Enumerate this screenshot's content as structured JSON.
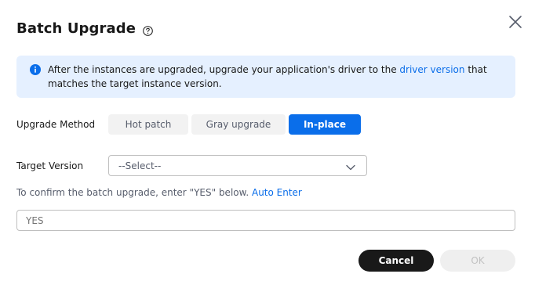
{
  "dialog": {
    "title": "Batch Upgrade",
    "help_icon": "question-circle-icon",
    "close_icon": "close-icon"
  },
  "alert": {
    "icon": "info-icon",
    "text_before": "After the instances are upgraded, upgrade your application's driver to the ",
    "link_text": "driver version",
    "text_after": " that matches the target instance version."
  },
  "upgrade_method": {
    "label": "Upgrade Method",
    "options": [
      "Hot patch",
      "Gray upgrade",
      "In-place"
    ],
    "selected": "In-place"
  },
  "target_version": {
    "label": "Target Version",
    "value": "--Select--",
    "icon": "chevron-down-icon"
  },
  "confirm": {
    "prompt": "To confirm the batch upgrade, enter \"YES\" below.",
    "auto_enter_link": "Auto Enter",
    "input_placeholder": "YES",
    "input_value": ""
  },
  "footer": {
    "cancel_label": "Cancel",
    "ok_label": "OK"
  },
  "colors": {
    "accent": "#0a6eea",
    "alert_bg": "#e5f0ff",
    "cancel_bg": "#191919",
    "ok_disabled_bg": "#efefef"
  }
}
